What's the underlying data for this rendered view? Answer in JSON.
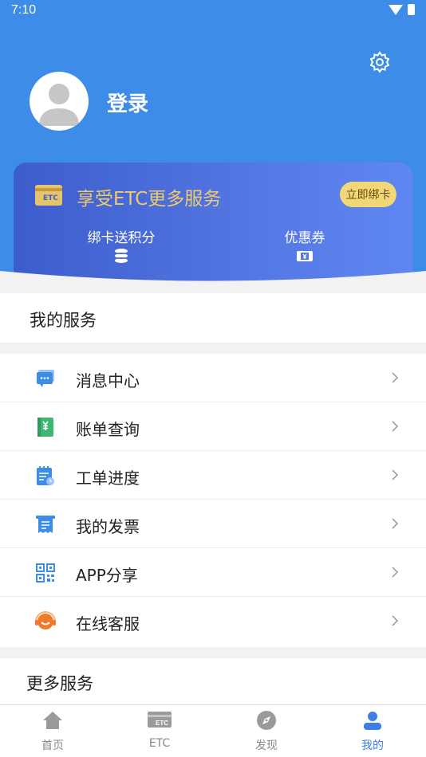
{
  "status_bar": {
    "time": "7:10"
  },
  "profile": {
    "login_label": "登录"
  },
  "etc_card": {
    "logo_text": "ETC",
    "promo_text": "享受ETC更多服务",
    "bind_button": "立即绑卡",
    "items": [
      {
        "label": "绑卡送积分",
        "icon": "coins-icon"
      },
      {
        "label": "优惠券",
        "icon": "coupon-icon"
      }
    ]
  },
  "my_services": {
    "title": "我的服务",
    "items": [
      {
        "label": "消息中心",
        "icon": "message-icon",
        "color": "#3d8de8"
      },
      {
        "label": "账单查询",
        "icon": "bill-icon",
        "color": "#3cb870"
      },
      {
        "label": "工单进度",
        "icon": "work-order-icon",
        "color": "#3d8de8"
      },
      {
        "label": "我的发票",
        "icon": "invoice-icon",
        "color": "#3d8de8"
      },
      {
        "label": "APP分享",
        "icon": "qr-code-icon",
        "color": "#3d8de8"
      },
      {
        "label": "在线客服",
        "icon": "customer-service-icon",
        "color": "#f07a2c"
      }
    ]
  },
  "more_services": {
    "title": "更多服务"
  },
  "tabbar": {
    "items": [
      {
        "label": "首页",
        "icon": "home-icon",
        "active": false
      },
      {
        "label": "ETC",
        "icon": "etc-card-icon",
        "active": false
      },
      {
        "label": "发现",
        "icon": "compass-icon",
        "active": false
      },
      {
        "label": "我的",
        "icon": "user-icon",
        "active": true
      }
    ]
  },
  "colors": {
    "primary": "#3d8de8",
    "gold": "#f0c96b",
    "active_tab": "#3d7ee8"
  }
}
